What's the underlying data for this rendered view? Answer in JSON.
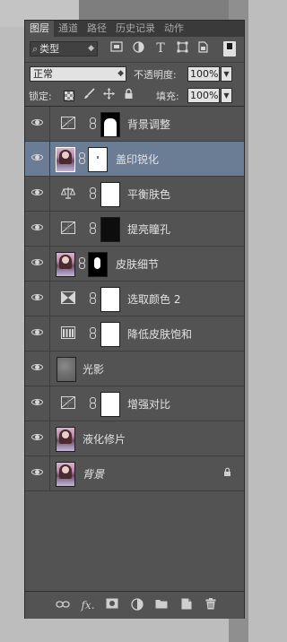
{
  "tabs": [
    {
      "label": "图层",
      "active": true
    },
    {
      "label": "通道",
      "active": false
    },
    {
      "label": "路径",
      "active": false
    },
    {
      "label": "历史记录",
      "active": false
    },
    {
      "label": "动作",
      "active": false
    }
  ],
  "filter": {
    "kind_label": "类型",
    "icons": [
      "pixel-filter-icon",
      "adjustment-filter-icon",
      "type-filter-icon",
      "shape-filter-icon",
      "smart-object-filter-icon"
    ],
    "type_glyph": "T"
  },
  "blend": {
    "mode": "正常",
    "opacity_label": "不透明度:",
    "opacity_value": "100%"
  },
  "lock": {
    "label": "锁定:",
    "fill_label": "填充:",
    "fill_value": "100%"
  },
  "layers": [
    {
      "name": "背景调整",
      "kind": "adj-levels",
      "mask": "bgadj",
      "selected": false
    },
    {
      "name": "盖印锐化",
      "kind": "photo",
      "mask": "stamp",
      "selected": true
    },
    {
      "name": "平衡肤色",
      "kind": "adj-balance",
      "mask": "white",
      "selected": false
    },
    {
      "name": "提亮瞳孔",
      "kind": "adj-levels",
      "mask": "black",
      "selected": false
    },
    {
      "name": "皮肤细节",
      "kind": "photo",
      "mask": "skin",
      "selected": false
    },
    {
      "name": "选取颜色 2",
      "kind": "adj-selective",
      "mask": "white",
      "selected": false
    },
    {
      "name": "降低皮肤饱和",
      "kind": "adj-hue",
      "mask": "white",
      "selected": false
    },
    {
      "name": "光影",
      "kind": "gray",
      "mask": "none",
      "selected": false
    },
    {
      "name": "增强对比",
      "kind": "adj-levels",
      "mask": "white",
      "selected": false
    },
    {
      "name": "液化修片",
      "kind": "photo",
      "mask": "none",
      "selected": false
    },
    {
      "name": "背景",
      "kind": "photo-bg",
      "mask": "none",
      "selected": false
    }
  ]
}
